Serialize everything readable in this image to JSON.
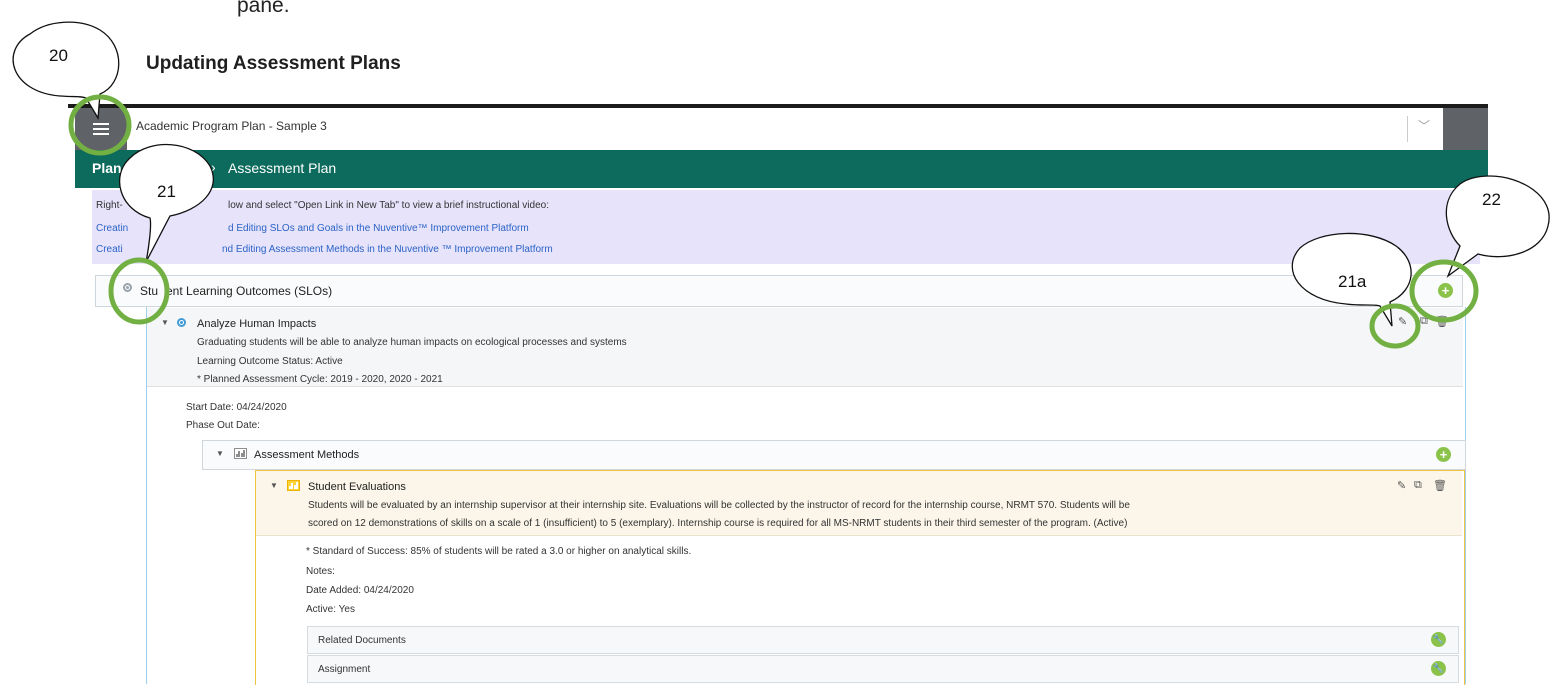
{
  "document": {
    "top_text": "pane.",
    "heading": "Updating Assessment Plans"
  },
  "callouts": {
    "c20": "20",
    "c21": "21",
    "c21a": "21a",
    "c22": "22"
  },
  "app": {
    "plan_title": "Academic Program Plan - Sample 3",
    "breadcrumb": {
      "plan": "Plan",
      "current": "Assessment Plan",
      "separator": "›"
    },
    "info": {
      "instruction": "low and select \"Open Link in New Tab\" to view a brief instructional video:",
      "instruction_prefix": "Right-",
      "link1_prefix": "Creatin",
      "link1": "d Editing SLOs and Goals in the Nuventive™ Improvement Platform",
      "link2_prefix": "Creati",
      "link2": "nd Editing Assessment Methods in the Nuventive ™ Improvement Platform"
    },
    "slo_section": {
      "title_prefix": "Stu",
      "title": "ent Learning Outcomes (SLOs)"
    },
    "outcome": {
      "title": "Analyze Human Impacts",
      "description": "Graduating students will be able to analyze human impacts on ecological processes and systems",
      "status": "Learning Outcome Status: Active",
      "cycle": "* Planned Assessment Cycle: 2019 - 2020, 2020 - 2021",
      "start_date_label": "Start Date:",
      "start_date": "04/24/2020",
      "phase_out_label": "Phase Out Date:"
    },
    "assessment_methods": {
      "title": "Assessment Methods"
    },
    "student_evaluations": {
      "title": "Student Evaluations",
      "desc_line1": "Students will be evaluated by an internship supervisor at their internship site. Evaluations will be collected by the instructor of record for the internship course, NRMT 570. Students will be",
      "desc_line2": "scored on 12 demonstrations of skills on a scale of 1 (insufficient) to 5 (exemplary). Internship course is required for all MS-NRMT students in their third semester of the program. (Active)",
      "standard_label": "* Standard of Success:",
      "standard": "85% of students will be rated a 3.0 or higher on analytical skills.",
      "notes_label": "Notes:",
      "date_added_label": "Date Added:",
      "date_added": "04/24/2020",
      "active_label": "Active:",
      "active": "Yes"
    },
    "subsections": [
      {
        "label": "Related Documents"
      },
      {
        "label": "Assignment"
      }
    ]
  }
}
